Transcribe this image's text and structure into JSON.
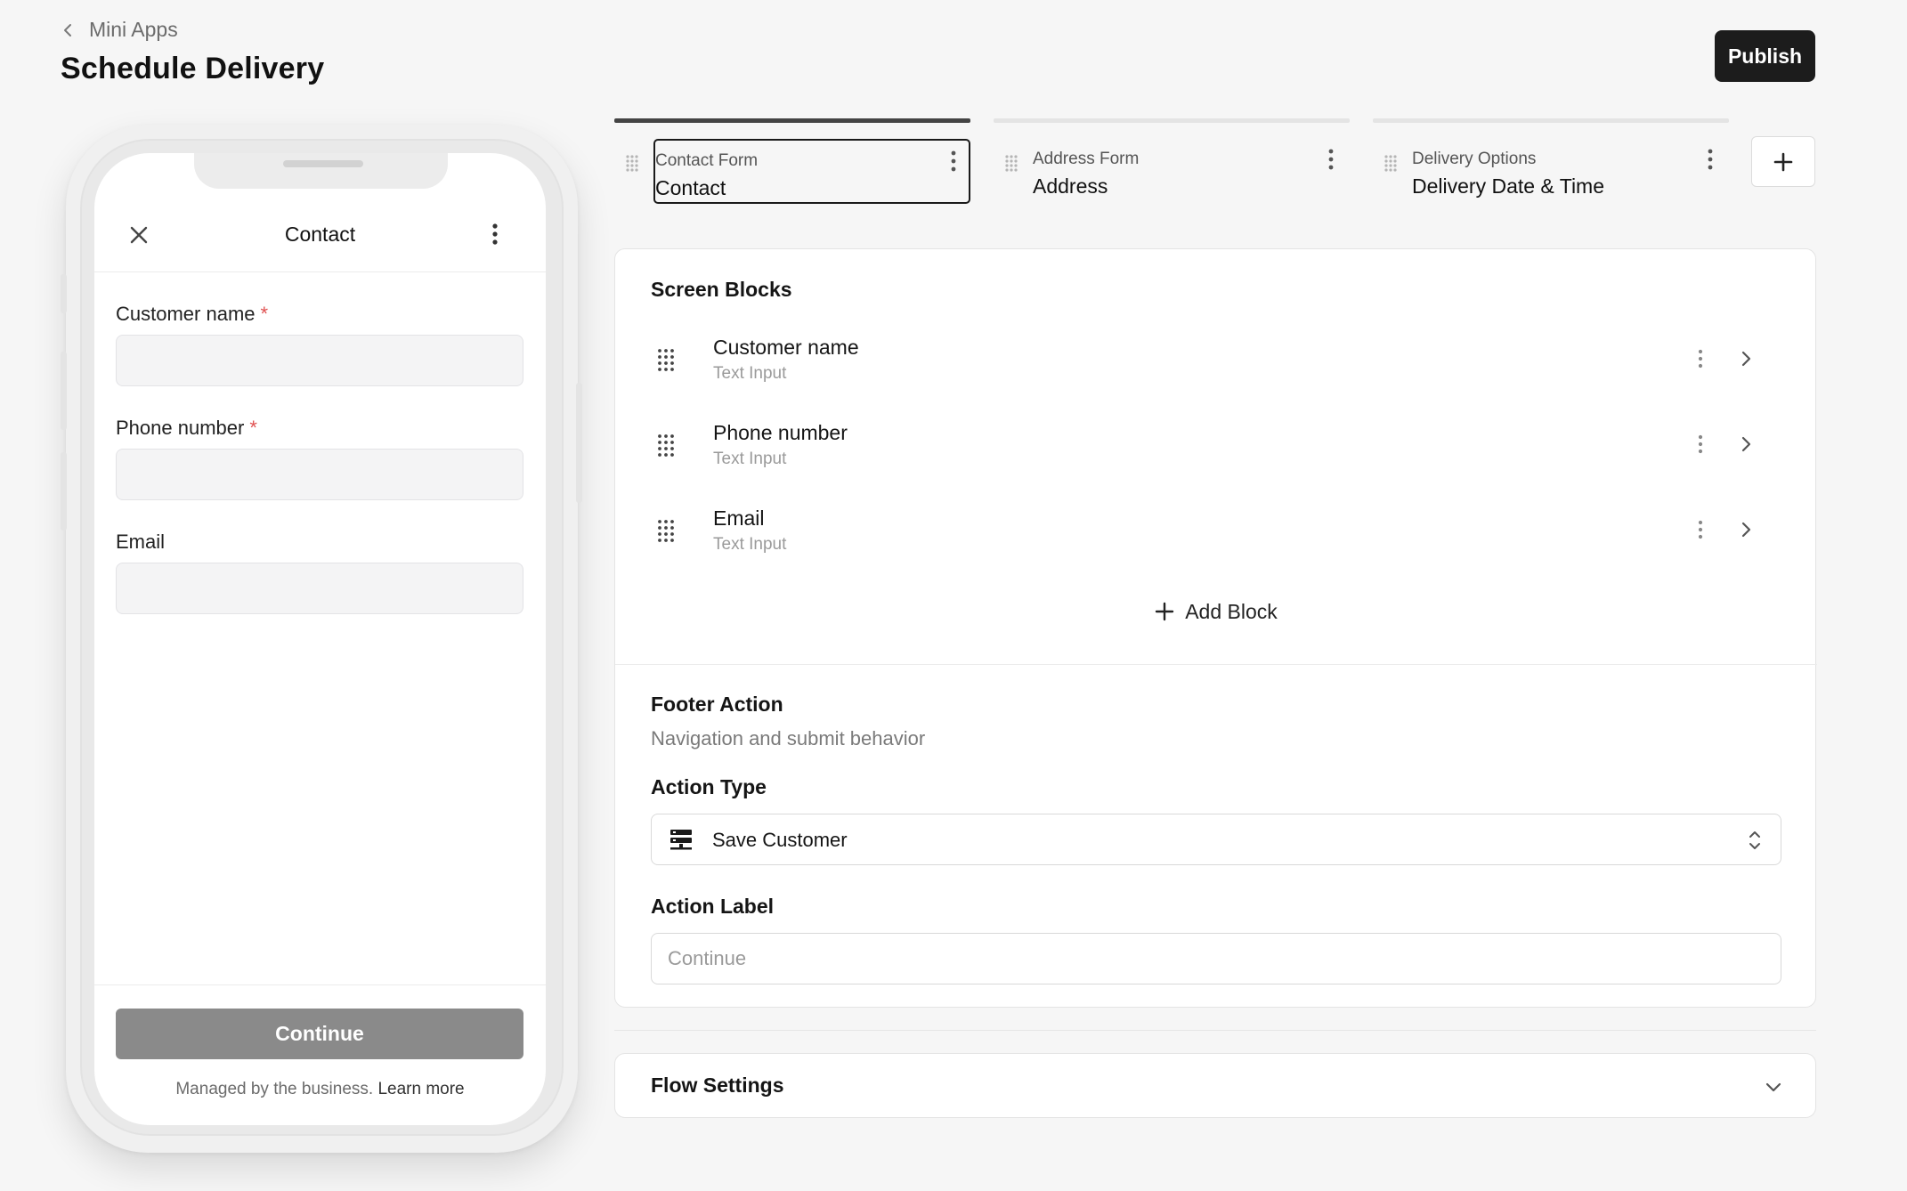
{
  "header": {
    "back_label": "Mini Apps",
    "title": "Schedule Delivery",
    "publish_label": "Publish"
  },
  "preview": {
    "screen_title": "Contact",
    "fields": [
      {
        "label": "Customer name",
        "required_mark": "*"
      },
      {
        "label": "Phone number",
        "required_mark": "*"
      },
      {
        "label": "Email"
      }
    ],
    "continue_label": "Continue",
    "managed_text": "Managed by the business.",
    "learn_more": "Learn more"
  },
  "tabs": [
    {
      "kicker": "Contact Form",
      "name": "Contact",
      "active": true
    },
    {
      "kicker": "Address Form",
      "name": "Address"
    },
    {
      "kicker": "Delivery Options",
      "name": "Delivery Date & Time"
    }
  ],
  "screen_blocks": {
    "title": "Screen Blocks",
    "items": [
      {
        "name": "Customer name",
        "type": "Text Input"
      },
      {
        "name": "Phone number",
        "type": "Text Input"
      },
      {
        "name": "Email",
        "type": "Text Input"
      }
    ],
    "add_label": "Add Block"
  },
  "footer_action": {
    "title": "Footer Action",
    "subtitle": "Navigation and submit behavior",
    "action_type_label": "Action Type",
    "action_type_value": "Save Customer",
    "action_label_label": "Action Label",
    "action_label_placeholder": "Continue"
  },
  "flow_settings": {
    "title": "Flow Settings"
  },
  "colors": {
    "primary_button": "#1c1c1c",
    "required": "#e05252",
    "preview_button": "#8a8a8a"
  }
}
